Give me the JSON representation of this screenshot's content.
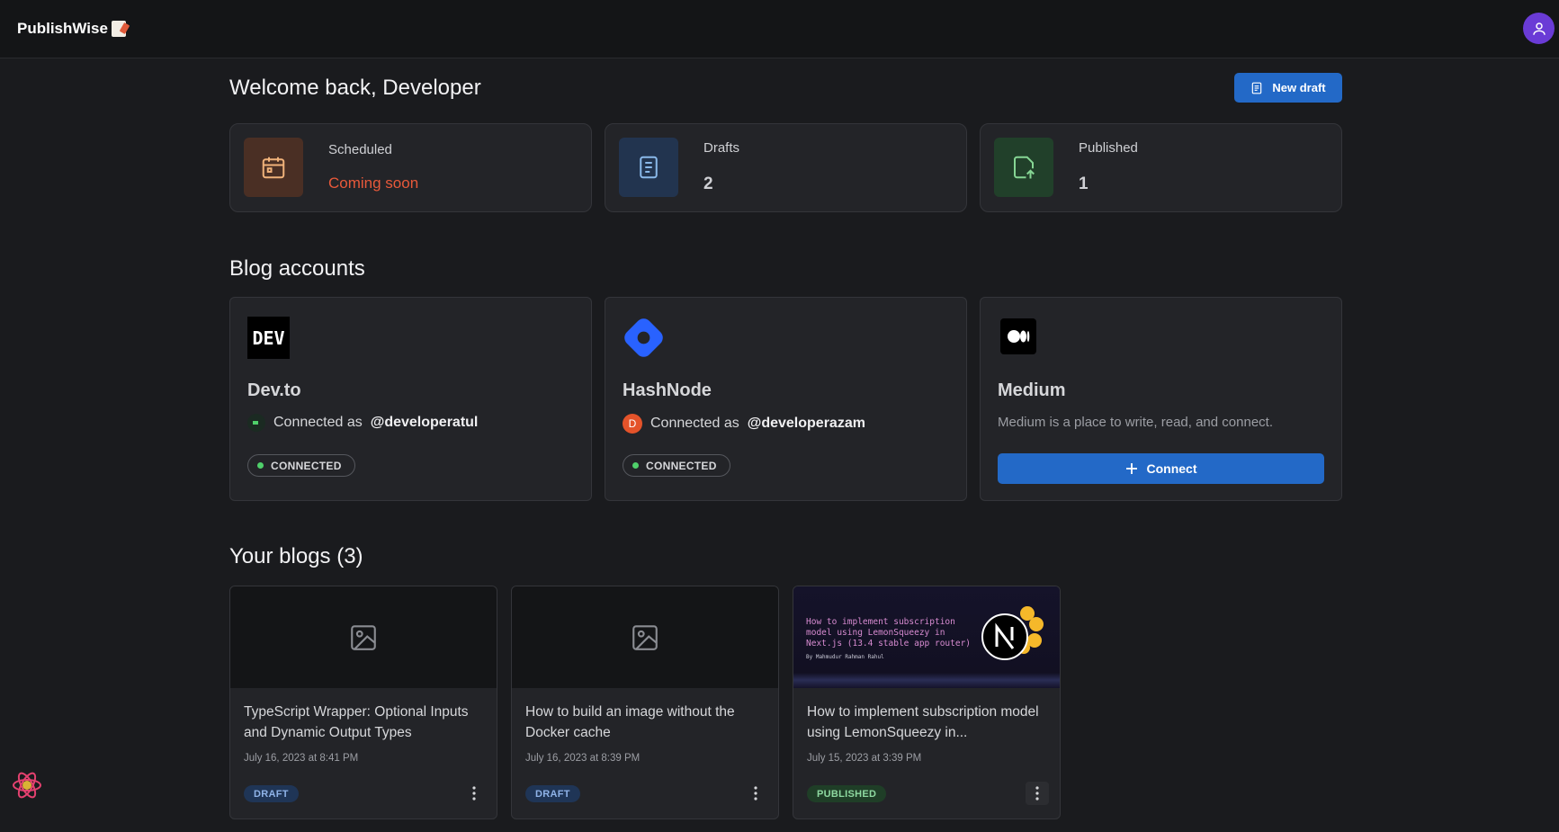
{
  "app": {
    "name": "PublishWise"
  },
  "header": {
    "welcome": "Welcome back, Developer",
    "new_draft_label": "New draft"
  },
  "stats": [
    {
      "label": "Scheduled",
      "value": "Coming soon",
      "icon": "calendar-icon",
      "accent": "#e8593a"
    },
    {
      "label": "Drafts",
      "value": "2",
      "icon": "document-icon",
      "accent": "#7fb1e3"
    },
    {
      "label": "Published",
      "value": "1",
      "icon": "upload-icon",
      "accent": "#7fd18e"
    }
  ],
  "accounts": {
    "title": "Blog accounts",
    "items": [
      {
        "name": "Dev.to",
        "connected_prefix": "Connected as",
        "username": "@developeratul",
        "status": "CONNECTED",
        "logo_text": "DEV"
      },
      {
        "name": "HashNode",
        "connected_prefix": "Connected as",
        "username": "@developerazam",
        "status": "CONNECTED",
        "avatar_letter": "D"
      },
      {
        "name": "Medium",
        "description": "Medium is a place to write, read, and connect.",
        "connect_label": "Connect"
      }
    ]
  },
  "blogs": {
    "title": "Your blogs (3)",
    "items": [
      {
        "title": "TypeScript Wrapper: Optional Inputs and Dynamic Output Types",
        "date": "July 16, 2023 at 8:41 PM",
        "status": "DRAFT"
      },
      {
        "title": "How to build an image without the Docker cache",
        "date": "July 16, 2023 at 8:39 PM",
        "status": "DRAFT"
      },
      {
        "title": "How to implement subscription model using LemonSqueezy in...",
        "date": "July 15, 2023 at 3:39 PM",
        "status": "PUBLISHED",
        "cover_text": "How to implement subscription model using LemonSqueezy in Next.js (13.4 stable app router)",
        "cover_author": "By Mahmudur Rahman Rahul"
      }
    ]
  },
  "colors": {
    "primary": "#2369c7",
    "draft_badge": "#1f3556",
    "published_badge": "#1f3e27"
  }
}
